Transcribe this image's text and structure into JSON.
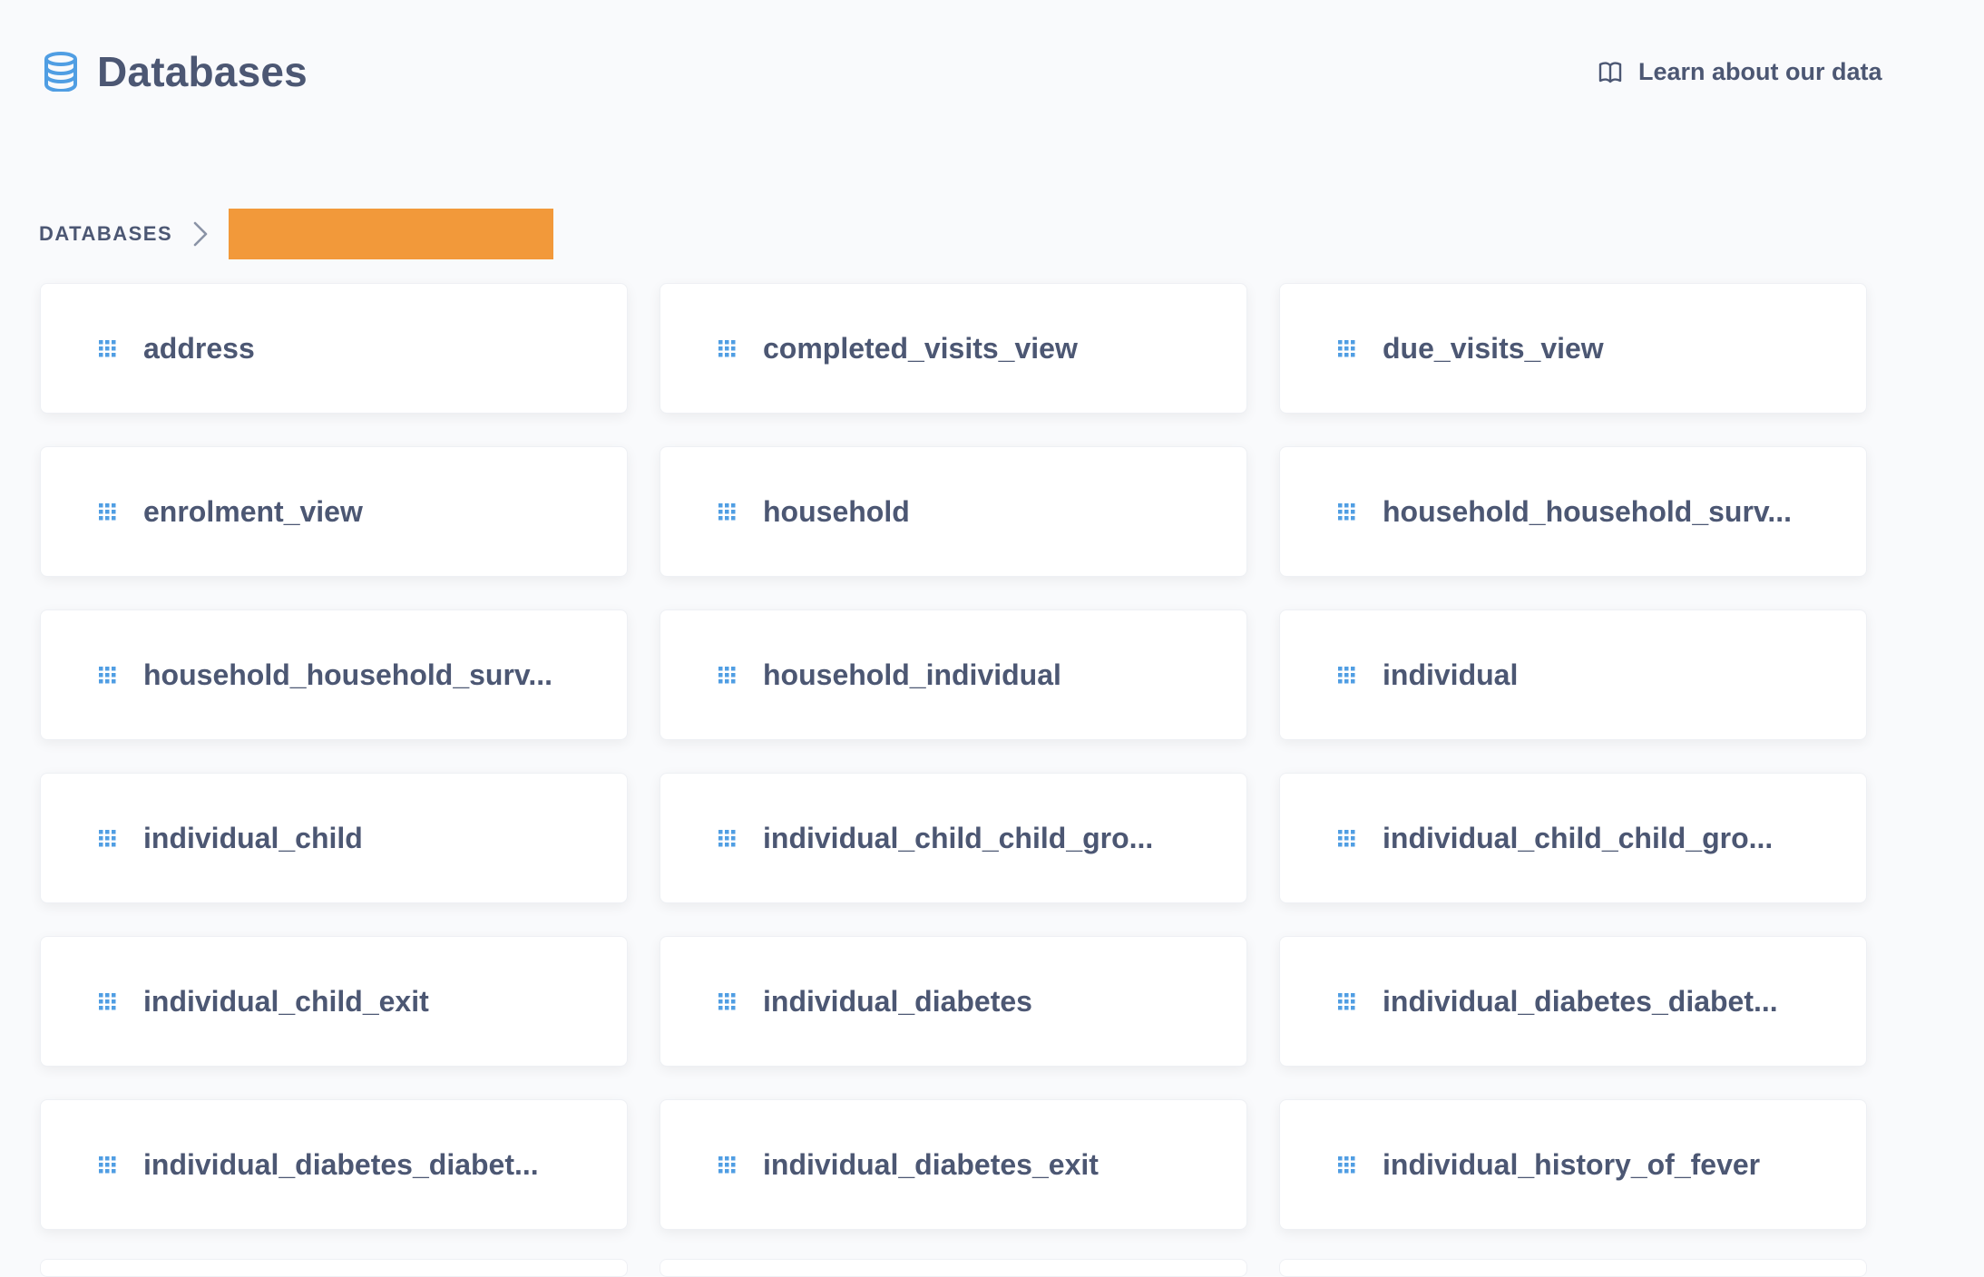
{
  "header": {
    "title": "Databases",
    "title_icon": "database-icon",
    "learn_link": "Learn about our data",
    "learn_icon": "book-icon"
  },
  "breadcrumb": {
    "root": "DATABASES",
    "separator_icon": "chevron-right-icon",
    "current_redacted_color": "#f2993a"
  },
  "tables": [
    {
      "label": "address"
    },
    {
      "label": "completed_visits_view"
    },
    {
      "label": "due_visits_view"
    },
    {
      "label": "enrolment_view"
    },
    {
      "label": "household"
    },
    {
      "label": "household_household_surv..."
    },
    {
      "label": "household_household_surv..."
    },
    {
      "label": "household_individual"
    },
    {
      "label": "individual"
    },
    {
      "label": "individual_child"
    },
    {
      "label": "individual_child_child_gro..."
    },
    {
      "label": "individual_child_child_gro..."
    },
    {
      "label": "individual_child_exit"
    },
    {
      "label": "individual_diabetes"
    },
    {
      "label": "individual_diabetes_diabet..."
    },
    {
      "label": "individual_diabetes_diabet..."
    },
    {
      "label": "individual_diabetes_exit"
    },
    {
      "label": "individual_history_of_fever"
    }
  ],
  "colors": {
    "accent": "#509ee3",
    "text": "#4c5773",
    "background": "#f9fafc"
  },
  "table_icon": "table-grid-icon"
}
